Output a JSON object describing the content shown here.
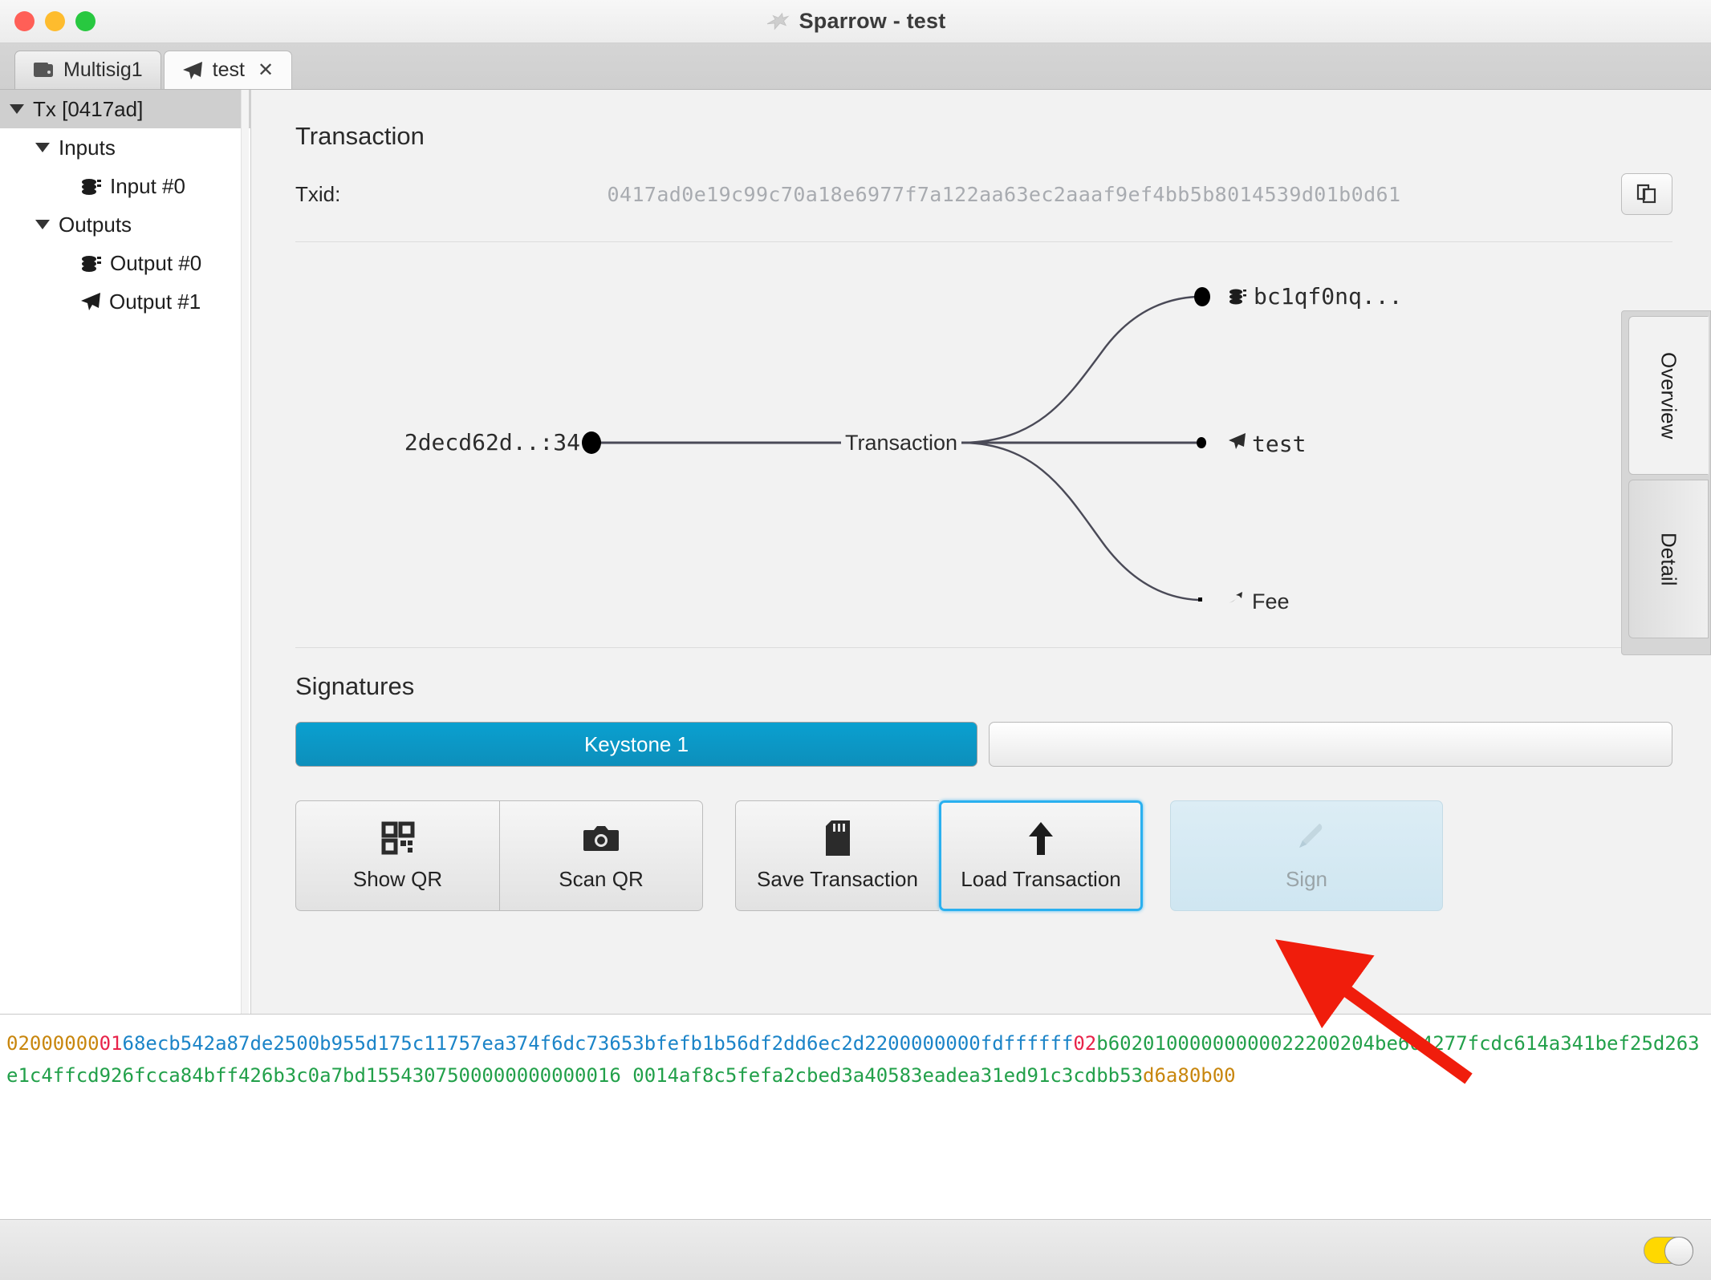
{
  "window": {
    "title": "Sparrow - test",
    "app_icon": "bird-icon",
    "controls": {
      "close": "close",
      "minimize": "minimize",
      "maximize": "maximize"
    }
  },
  "tabs": [
    {
      "label": "Multisig1",
      "icon": "wallet-icon",
      "active": false,
      "closable": false
    },
    {
      "label": "test",
      "icon": "plane-icon",
      "active": true,
      "closable": true,
      "close_glyph": "✕"
    }
  ],
  "sidebar": {
    "items": [
      {
        "label": "Tx [0417ad]",
        "level": 0,
        "caret": "open",
        "icon": null,
        "selected": true
      },
      {
        "label": "Inputs",
        "level": 1,
        "caret": "open",
        "icon": null,
        "selected": false
      },
      {
        "label": "Input #0",
        "level": 2,
        "caret": null,
        "icon": "coins-icon",
        "selected": false
      },
      {
        "label": "Outputs",
        "level": 1,
        "caret": "open",
        "icon": null,
        "selected": false
      },
      {
        "label": "Output #0",
        "level": 2,
        "caret": null,
        "icon": "coins-icon",
        "selected": false
      },
      {
        "label": "Output #1",
        "level": 2,
        "caret": null,
        "icon": "plane-icon",
        "selected": false
      }
    ]
  },
  "main": {
    "transaction_heading": "Transaction",
    "txid_label": "Txid:",
    "txid_value": "0417ad0e19c99c70a18e6977f7a122aa63ec2aaaf9ef4bb5b8014539d01b0d61",
    "copy_button": "copy-icon",
    "side_tabs": [
      {
        "label": "Overview",
        "active": true
      },
      {
        "label": "Detail",
        "active": false
      }
    ],
    "diagram": {
      "center_label": "Transaction",
      "input": {
        "label": "2decd62d..:34"
      },
      "outputs": [
        {
          "label": "bc1qf0nq...",
          "icon": "coins-icon"
        },
        {
          "label": "test",
          "icon": "plane-icon"
        },
        {
          "label": "Fee",
          "icon": "fee-icon"
        }
      ]
    },
    "signatures_heading": "Signatures",
    "signature_bars": [
      {
        "label": "Keystone 1",
        "filled": true
      },
      {
        "label": "",
        "filled": false
      }
    ],
    "buttons": [
      {
        "label": "Show QR",
        "icon": "qr-code-icon",
        "state": "normal"
      },
      {
        "label": "Scan QR",
        "icon": "camera-icon",
        "state": "normal"
      },
      {
        "label": "Save Transaction",
        "icon": "sd-card-icon",
        "state": "normal"
      },
      {
        "label": "Load Transaction",
        "icon": "arrow-up-icon",
        "state": "focused"
      },
      {
        "label": "Sign",
        "icon": "pen-nib-icon",
        "state": "disabled"
      }
    ]
  },
  "hexdump": {
    "segments": [
      {
        "text": "02000000",
        "color_name": "orange",
        "color": "#c8860d"
      },
      {
        "text": "01",
        "color_name": "red",
        "color": "#e8234a"
      },
      {
        "text": "68ecb542a87de2500b955d175c11757ea374f6dc73653bfefb1b56df2dd6ec2d2200000000fdffffff",
        "color_name": "blue",
        "color": "#1b84c8"
      },
      {
        "text": "02",
        "color_name": "red",
        "color": "#e8234a"
      },
      {
        "text": "b60201000000000022200204be604277fcdc614a341bef25d263e1c4ffcd926fcca84bff426b3c0a7bd1554307500000000000016 0014af8c5fefa2cbed3a40583eadea31ed91c3cdbb53",
        "color_name": "green",
        "color": "#22a04a"
      },
      {
        "text": "d6a80b00",
        "color_name": "orange",
        "color": "#c8860d"
      }
    ],
    "line1": "02000000 01 68ecb542a87de2500b955d175c11757ea374f6dc73653bfefb1b56df2dd6ec2d2200000000fdffffff 02 b60201000000000022200204be604277fcdc614a341",
    "line2": "bef25d263e1c4ffcd926fcca84bff426b3c0a7bd15543075000000000000160014af8c5fefa2cbed3a40583eadea31ed91c3cdbb53 d6a80b00"
  },
  "statusbar": {
    "toggle": {
      "name": "theme-toggle",
      "state": "on",
      "color": "#ffd800"
    }
  },
  "annotation": {
    "arrow": {
      "color": "#f01d0c",
      "points_to": "Load Transaction"
    }
  },
  "colors": {
    "accent_blue": "#0d8fbb",
    "focus_blue": "#2ab0ef",
    "hex_orange": "#c8860d",
    "hex_red": "#e8234a",
    "hex_blue": "#1b84c8",
    "hex_green": "#22a04a",
    "toggle_yellow": "#ffd800",
    "arrow_red": "#f01d0c"
  }
}
